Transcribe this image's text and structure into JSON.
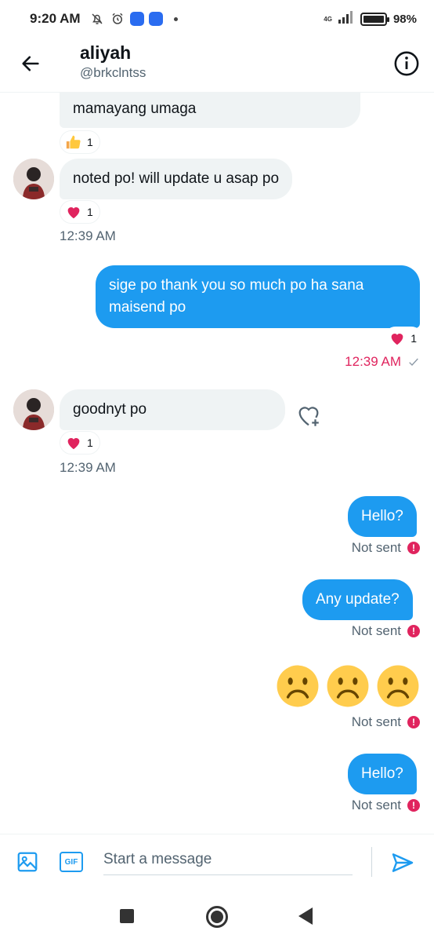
{
  "status_bar": {
    "time": "9:20 AM",
    "network": "4G",
    "battery": "98%"
  },
  "header": {
    "name": "aliyah",
    "handle": "@brkclntss"
  },
  "messages": {
    "m1": {
      "text": "mamayang umaga",
      "reaction_emoji": "thumbs-up",
      "reaction_count": "1"
    },
    "m2": {
      "text": "noted po! will update u asap po",
      "reaction_count": "1",
      "time": "12:39 AM"
    },
    "m3": {
      "text": "sige po thank you so much po ha sana maisend po",
      "reaction_count": "1",
      "time": "12:39 AM"
    },
    "m4": {
      "text": "goodnyt po",
      "reaction_count": "1",
      "time": "12:39 AM"
    },
    "m5": {
      "text": "Hello?",
      "status": "Not sent"
    },
    "m6": {
      "text": "Any update?",
      "status": "Not sent"
    },
    "m7": {
      "emoji": [
        "frowning-face",
        "frowning-face",
        "frowning-face"
      ],
      "status": "Not sent"
    },
    "m8": {
      "text": "Hello?",
      "status": "Not sent"
    }
  },
  "composer": {
    "placeholder": "Start a message",
    "gif_label": "GIF"
  },
  "colors": {
    "accent": "#1d9bf0",
    "error": "#e0245e",
    "bubble_in": "#eff3f4"
  }
}
